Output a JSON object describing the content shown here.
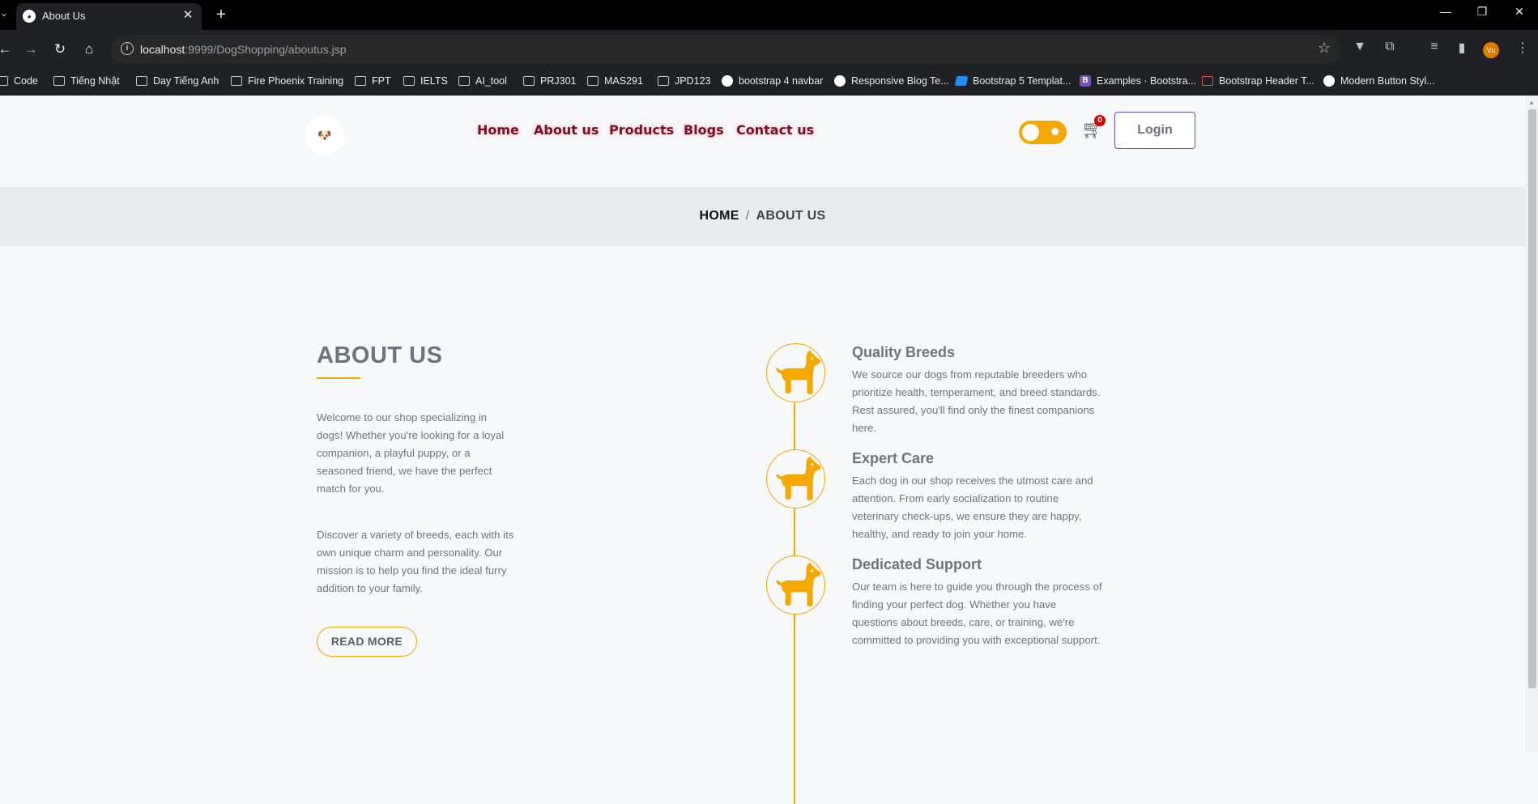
{
  "browser": {
    "tab_title": "About Us",
    "url_host": "localhost",
    "url_path": ":9999/DogShopping/aboutus.jsp",
    "profile_initials": "Vu",
    "bookmarks": [
      {
        "label": "Code",
        "icon": "folder-icon"
      },
      {
        "label": "Tiếng Nhật",
        "icon": "folder-icon"
      },
      {
        "label": "Day Tiếng Anh",
        "icon": "folder-icon"
      },
      {
        "label": "Fire Phoenix Training",
        "icon": "folder-icon"
      },
      {
        "label": "FPT",
        "icon": "folder-icon"
      },
      {
        "label": "IELTS",
        "icon": "folder-icon"
      },
      {
        "label": "AI_tool",
        "icon": "folder-icon"
      },
      {
        "label": "PRJ301",
        "icon": "folder-icon"
      },
      {
        "label": "MAS291",
        "icon": "folder-icon"
      },
      {
        "label": "JPD123",
        "icon": "folder-icon"
      },
      {
        "label": "bootstrap 4 navbar",
        "icon": "site-icon"
      },
      {
        "label": "Responsive Blog Te...",
        "icon": "site-icon"
      },
      {
        "label": "Bootstrap 5 Templat...",
        "icon": "site-icon"
      },
      {
        "label": "Examples · Bootstra...",
        "icon": "bootstrap-icon"
      },
      {
        "label": "Bootstrap Header T...",
        "icon": "site-icon"
      },
      {
        "label": "Modern Button Styl...",
        "icon": "site-icon"
      }
    ]
  },
  "header": {
    "logo_text": "🐶",
    "nav": [
      "Home",
      "About us",
      "Products",
      "Blogs",
      "Contact us"
    ],
    "cart_count": "0",
    "login_label": "Login"
  },
  "breadcrumb": {
    "home": "HOME",
    "separator": "/",
    "current": "ABOUT US"
  },
  "about": {
    "title": "ABOUT US",
    "paragraph1": "Welcome to our shop specializing in dogs! Whether you're looking for a loyal companion, a playful puppy, or a seasoned friend, we have the perfect match for you.",
    "paragraph2": "Discover a variety of breeds, each with its own unique charm and personality. Our mission is to help you find the ideal furry addition to your family.",
    "read_more": "READ MORE"
  },
  "features": [
    {
      "title": "Quality Breeds",
      "description": "We source our dogs from reputable breeders who prioritize health, temperament, and breed standards. Rest assured, you'll find only the finest companions here."
    },
    {
      "title": "Expert Care",
      "description": "Each dog in our shop receives the utmost care and attention. From early socialization to routine veterinary check-ups, we ensure they are happy, healthy, and ready to join your home."
    },
    {
      "title": "Dedicated Support",
      "description": "Our team is here to guide you through the process of finding your perfect dog. Whether you have questions about breeds, care, or training, we're committed to providing you with exceptional support."
    }
  ],
  "colors": {
    "accent": "#f5a800",
    "nav_text": "#7a1020",
    "body_text": "#6c757d",
    "login_border": "#5a4cdb"
  }
}
